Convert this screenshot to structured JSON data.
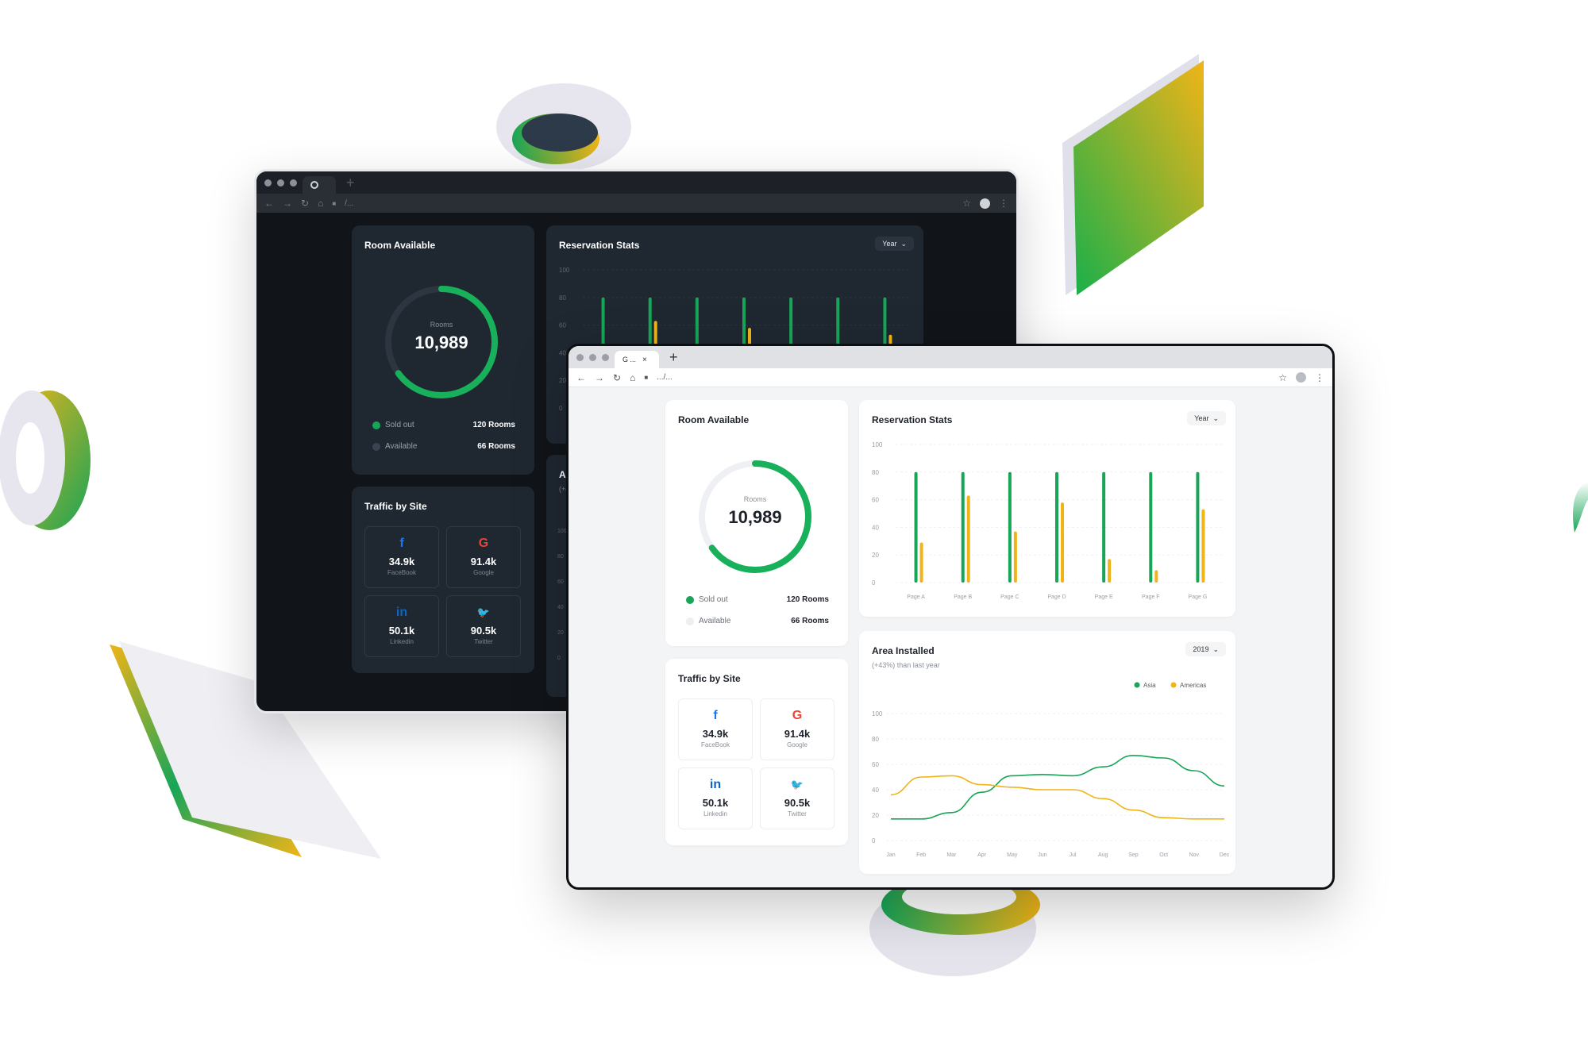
{
  "colors": {
    "green": "#18a558",
    "orange": "#f0b418",
    "dark_bg": "#111418",
    "dark_card": "#1f2731",
    "light_bg": "#f3f4f6",
    "light_card": "#ffffff"
  },
  "dark_window": {
    "tab": {
      "icon": "chrome-icon"
    },
    "address": {
      "url": "/..."
    },
    "room_card": {
      "title": "Room Available",
      "donut_label": "Rooms",
      "donut_value": "10,989",
      "donut_fraction": 0.65,
      "legend": [
        {
          "label": "Sold out",
          "value": "120 Rooms",
          "color": "#18a558"
        },
        {
          "label": "Available",
          "value": "66 Rooms",
          "color": "#3a4450"
        }
      ]
    },
    "traffic_card": {
      "title": "Traffic by Site",
      "sites": [
        {
          "icon": "facebook-icon",
          "glyph": "f",
          "value": "34.9k",
          "name": "FaceBook",
          "color": "#1877f2"
        },
        {
          "icon": "google-icon",
          "glyph": "G",
          "value": "91.4k",
          "name": "Google",
          "color": "#ea4335"
        },
        {
          "icon": "linkedin-icon",
          "glyph": "in",
          "value": "50.1k",
          "name": "Linkedin",
          "color": "#0a66c2"
        },
        {
          "icon": "twitter-icon",
          "glyph": "🐦",
          "value": "90.5k",
          "name": "Twitter",
          "color": "#1da1f2"
        }
      ]
    },
    "stats_card": {
      "title": "Reservation Stats",
      "selector": "Year"
    },
    "area_card": {
      "title_partial": "Ar",
      "subtitle_partial": "(+4"
    }
  },
  "light_window": {
    "tab": {
      "icon": "google-tab-icon",
      "title": "G ..."
    },
    "address": {
      "url": ".../..."
    },
    "room_card": {
      "title": "Room Available",
      "donut_label": "Rooms",
      "donut_value": "10,989",
      "donut_fraction": 0.65,
      "legend": [
        {
          "label": "Sold out",
          "value": "120 Rooms",
          "color": "#18a558"
        },
        {
          "label": "Available",
          "value": "66 Rooms",
          "color": "#eceef1"
        }
      ]
    },
    "traffic_card": {
      "title": "Traffic by Site",
      "sites": [
        {
          "icon": "facebook-icon",
          "glyph": "f",
          "value": "34.9k",
          "name": "FaceBook",
          "color": "#1877f2"
        },
        {
          "icon": "google-icon",
          "glyph": "G",
          "value": "91.4k",
          "name": "Google",
          "color": "#ea4335"
        },
        {
          "icon": "linkedin-icon",
          "glyph": "in",
          "value": "50.1k",
          "name": "Linkedin",
          "color": "#0a66c2"
        },
        {
          "icon": "twitter-icon",
          "glyph": "🐦",
          "value": "90.5k",
          "name": "Twitter",
          "color": "#1da1f2"
        }
      ]
    },
    "stats_card": {
      "title": "Reservation Stats",
      "selector": "Year"
    },
    "area_card": {
      "title": "Area Installed",
      "subtitle": "(+43%) than last year",
      "selector": "2019"
    }
  },
  "chart_data": [
    {
      "type": "bar",
      "title": "Reservation Stats",
      "categories": [
        "Page A",
        "Page B",
        "Page C",
        "Page D",
        "Page E",
        "Page F",
        "Page G"
      ],
      "series": [
        {
          "values": [
            80,
            80,
            80,
            80,
            80,
            80,
            80
          ],
          "color": "#18a558"
        },
        {
          "values": [
            29,
            63,
            37,
            58,
            17,
            9,
            53
          ],
          "color": "#f0b418"
        }
      ],
      "ylim": [
        0,
        100
      ],
      "yticks": [
        0,
        20,
        40,
        60,
        80,
        100
      ],
      "grid": true
    },
    {
      "type": "line",
      "title": "Area Installed",
      "subtitle": "(+43%) than last year",
      "categories": [
        "Jan",
        "Feb",
        "Mar",
        "Apr",
        "May",
        "Jun",
        "Jul",
        "Aug",
        "Sep",
        "Oct",
        "Nov",
        "Dec"
      ],
      "series": [
        {
          "name": "Asia",
          "values": [
            17,
            17,
            22,
            38,
            51,
            52,
            51,
            58,
            67,
            65,
            55,
            43
          ],
          "color": "#18a558"
        },
        {
          "name": "Americas",
          "values": [
            36,
            50,
            51,
            44,
            42,
            40,
            40,
            33,
            24,
            18,
            17,
            17
          ],
          "color": "#f0b418"
        }
      ],
      "ylim": [
        0,
        100
      ],
      "yticks": [
        0,
        20,
        40,
        60,
        80,
        100
      ],
      "legend": "top-right",
      "grid": true
    }
  ]
}
